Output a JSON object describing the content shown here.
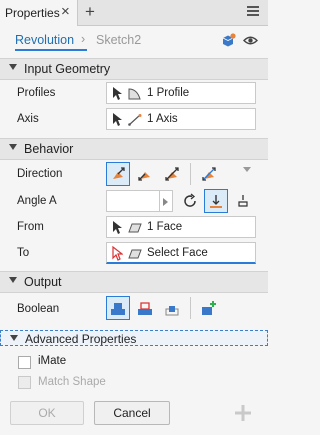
{
  "titlebar": {
    "tab_label": "Properties",
    "close_glyph": "×",
    "add_glyph": "+"
  },
  "breadcrumb": {
    "active": "Revolution",
    "separator": "›",
    "inactive": "Sketch2"
  },
  "sections": {
    "input_geometry": {
      "title": "Input Geometry",
      "profiles_label": "Profiles",
      "profiles_value": "1 Profile",
      "axis_label": "Axis",
      "axis_value": "1 Axis"
    },
    "behavior": {
      "title": "Behavior",
      "direction_label": "Direction",
      "angle_label": "Angle A",
      "angle_value": "",
      "from_label": "From",
      "from_value": "1 Face",
      "to_label": "To",
      "to_value": "Select Face"
    },
    "output": {
      "title": "Output",
      "boolean_label": "Boolean"
    },
    "advanced": {
      "title": "Advanced Properties",
      "imate_label": "iMate",
      "match_shape_label": "Match Shape"
    }
  },
  "footer": {
    "ok_label": "OK",
    "cancel_label": "Cancel"
  },
  "colors": {
    "accent": "#2b7bd8",
    "orange": "#e8833a",
    "link": "#1f6fb2"
  }
}
